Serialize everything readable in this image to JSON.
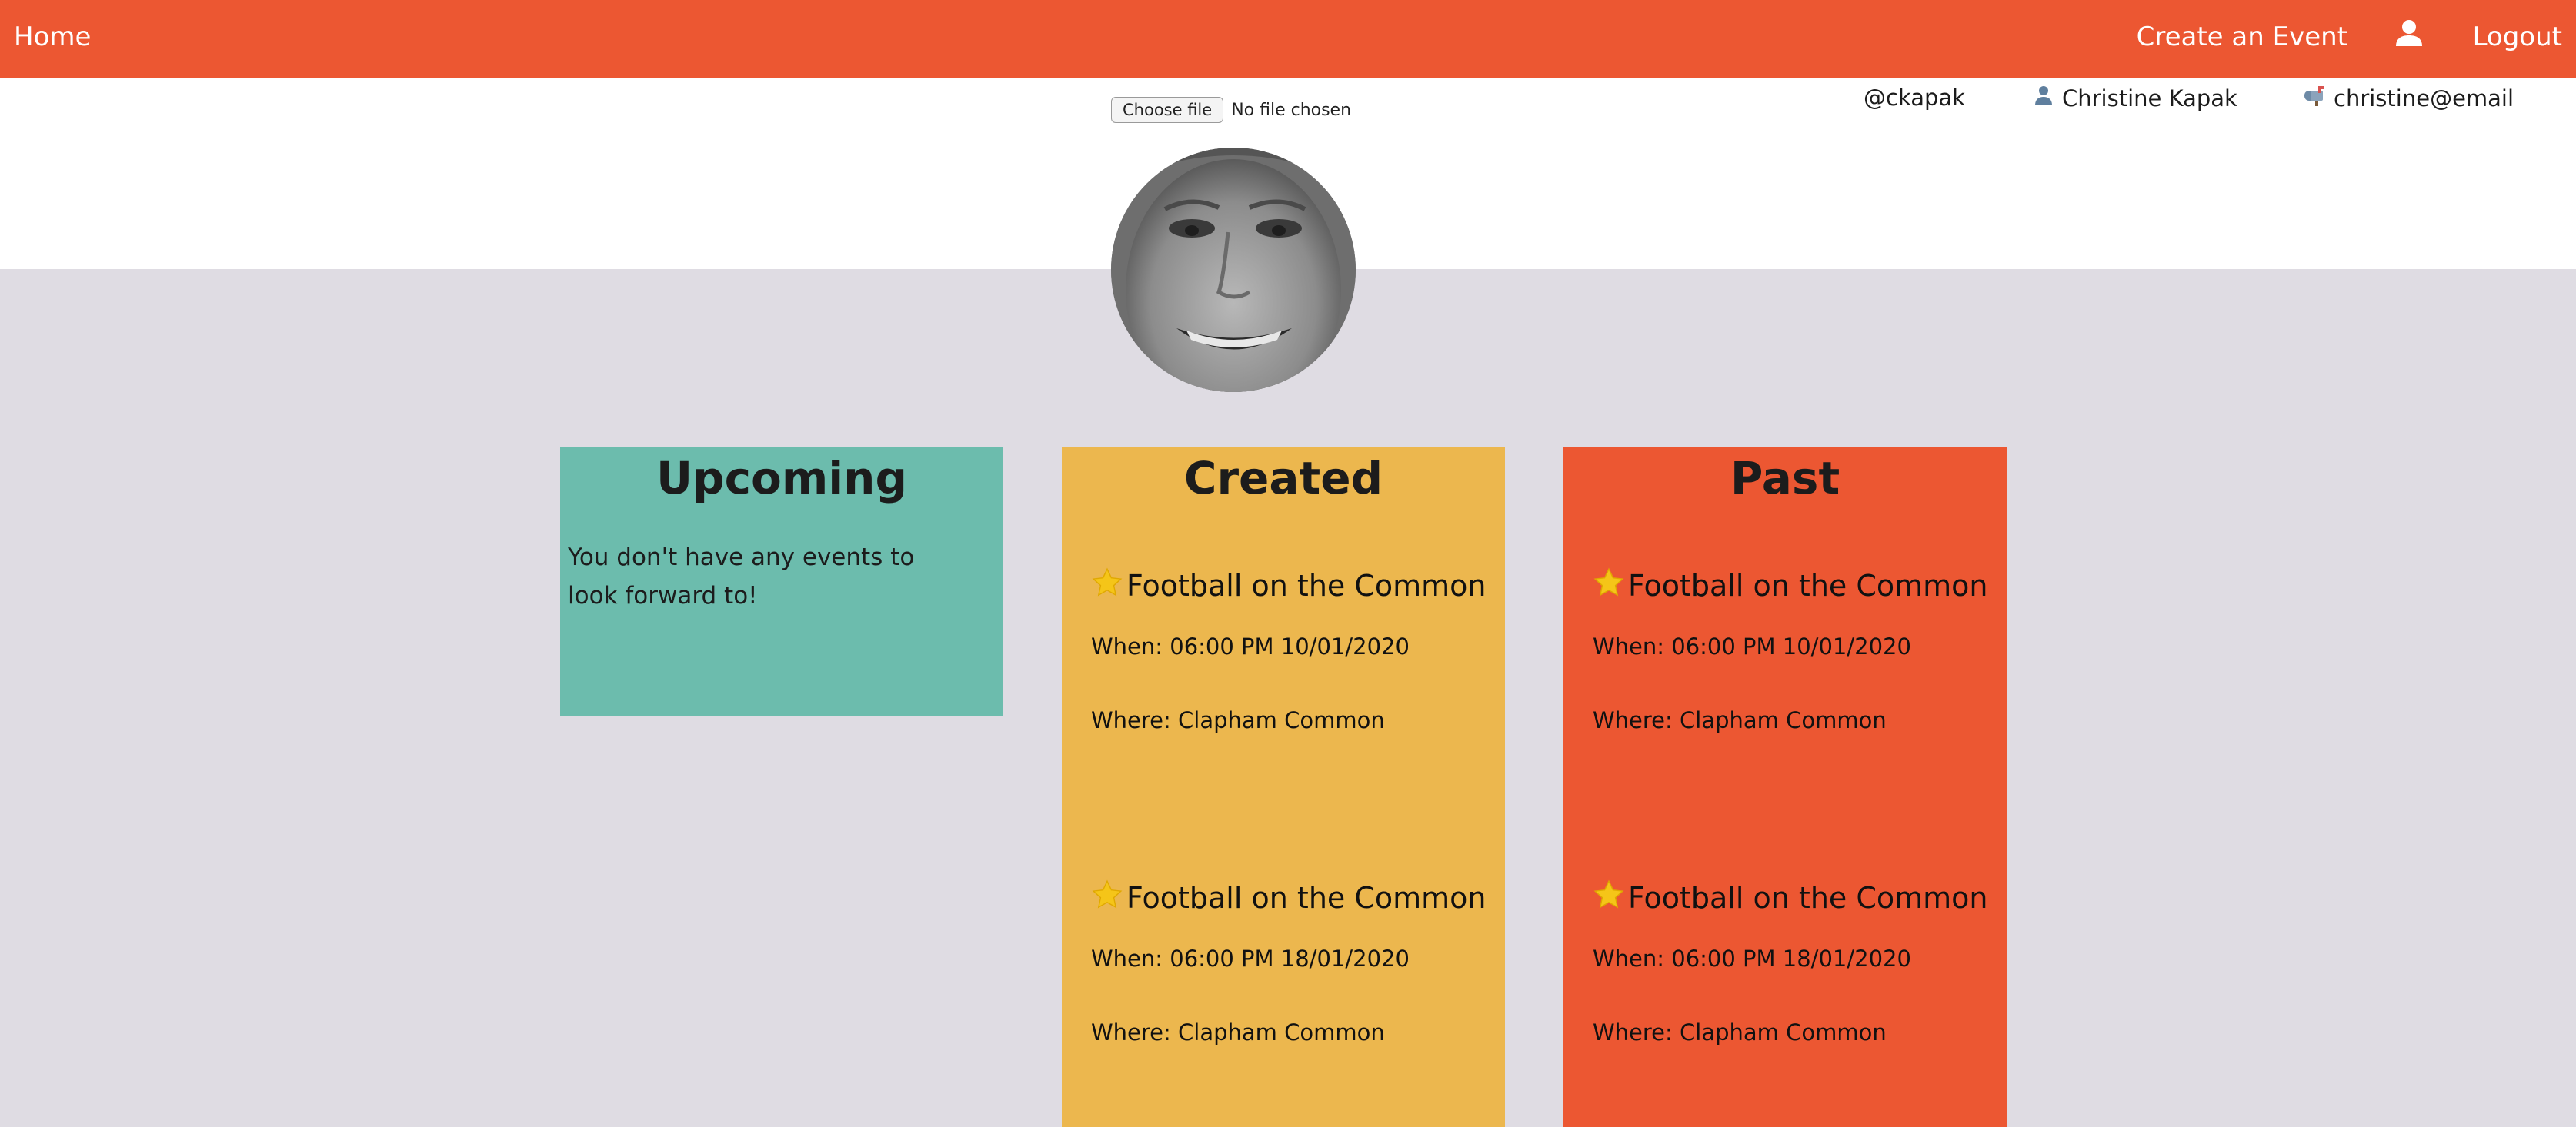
{
  "nav": {
    "home": "Home",
    "create_event": "Create an Event",
    "user_icon": "user-icon",
    "logout": "Logout"
  },
  "upload": {
    "button_label": "Choose file",
    "status": "No file chosen"
  },
  "profile": {
    "username": "@ckapak",
    "name": "Christine Kapak",
    "email": "christine@email",
    "name_icon": "person-icon",
    "email_icon": "mailbox-icon",
    "avatar": "profile-photo"
  },
  "columns": {
    "upcoming": {
      "title": "Upcoming",
      "empty_message": "You don't have any events to look forward to!"
    },
    "created": {
      "title": "Created",
      "events": [
        {
          "title": "Football on the Common",
          "when": "When: 06:00 PM 10/01/2020",
          "where": "Where: Clapham Common"
        },
        {
          "title": "Football on the Common",
          "when": "When: 06:00 PM 18/01/2020",
          "where": "Where: Clapham Common"
        }
      ]
    },
    "past": {
      "title": "Past",
      "events": [
        {
          "title": "Football on the Common",
          "when": "When: 06:00 PM 10/01/2020",
          "where": "Where: Clapham Common"
        },
        {
          "title": "Football on the Common",
          "when": "When: 06:00 PM 18/01/2020",
          "where": "Where: Clapham Common"
        }
      ]
    }
  },
  "colors": {
    "nav_bg": "#ec5732",
    "page_bg": "#dfdce3",
    "upcoming_bg": "#6cbcad",
    "created_bg": "#ecb74e",
    "past_bg": "#ec5732",
    "star": "#f5c518"
  },
  "icons": {
    "event_star": "star-icon"
  }
}
